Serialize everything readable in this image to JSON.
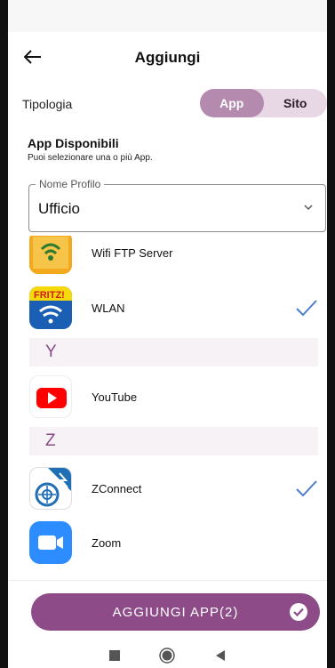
{
  "header": {
    "title": "Aggiungi"
  },
  "tipologia": {
    "label": "Tipologia",
    "options": [
      "App",
      "Sito"
    ],
    "selected": "App"
  },
  "section": {
    "title": "App Disponibili",
    "subtitle": "Puoi selezionare una o più App."
  },
  "profile": {
    "legend": "Nome Profilo",
    "value": "Ufficio"
  },
  "apps": [
    {
      "name": "Wifi FTP Server",
      "icon": "wifi-ftp-server-icon",
      "checked": false
    },
    {
      "name": "WLAN",
      "icon": "fritz-wlan-icon",
      "checked": true
    },
    {
      "letter": "Y"
    },
    {
      "name": "YouTube",
      "icon": "youtube-icon",
      "checked": false
    },
    {
      "letter": "Z"
    },
    {
      "name": "ZConnect",
      "icon": "zconnect-icon",
      "checked": true
    },
    {
      "name": "Zoom",
      "icon": "zoom-icon",
      "checked": false
    }
  ],
  "add_button": {
    "label": "AGGIUNGI APP(2)"
  },
  "colors": {
    "accent": "#8d4b87",
    "segment_active": "#b48aaf",
    "segment_bg": "#e8d8e6",
    "check": "#4a7cc9"
  }
}
